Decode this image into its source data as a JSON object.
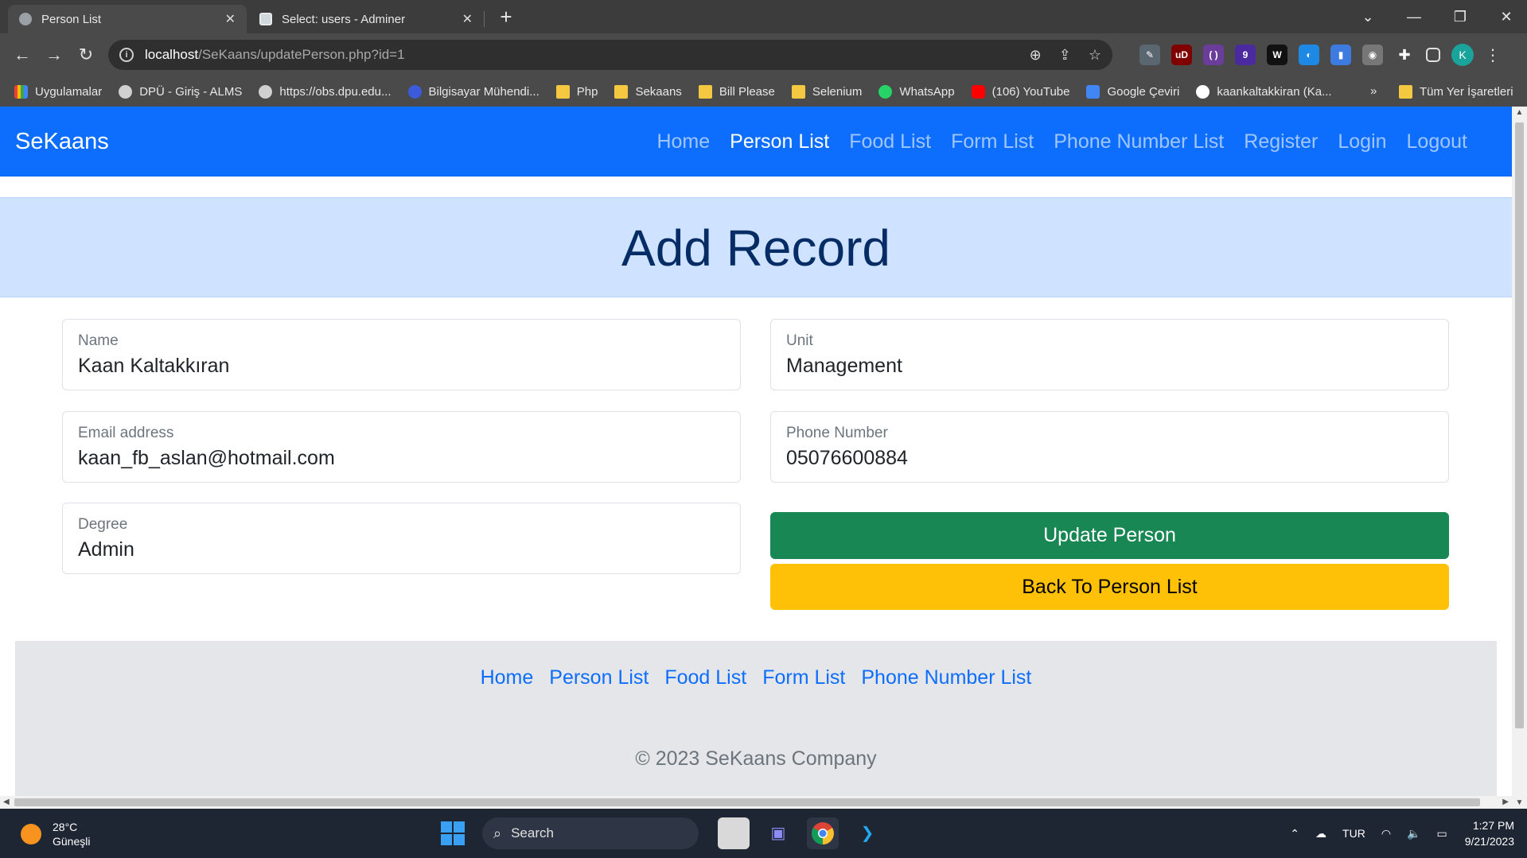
{
  "browser": {
    "tabs": [
      {
        "label": "Person List",
        "active": true
      },
      {
        "label": "Select: users - Adminer",
        "active": false
      }
    ],
    "tab_close": "✕",
    "new_tab": "+",
    "window_controls": {
      "dropdown": "⌄",
      "minimize": "—",
      "restore": "❐",
      "close": "✕"
    },
    "nav": {
      "back": "←",
      "forward": "→",
      "reload": "↻"
    },
    "url": {
      "host": "localhost",
      "path": "/SeKaans/updatePerson.php?id=1"
    },
    "omni_icons": {
      "zoom": "⊕",
      "share": "⇪",
      "star": "☆"
    },
    "extensions": [
      {
        "name": "pen-extension-icon",
        "label": "✎",
        "color": "#5b6770"
      },
      {
        "name": "ublock-extension-icon",
        "label": "uD",
        "color": "#800000"
      },
      {
        "name": "brackets-extension-icon",
        "label": "( )",
        "color": "#6a3d9a"
      },
      {
        "name": "hat-extension-icon",
        "label": "9",
        "color": "#4b2aa0"
      },
      {
        "name": "w-extension-icon",
        "label": "W",
        "color": "#111111"
      },
      {
        "name": "edge-extension-icon",
        "label": "◐",
        "color": "#1e88e5"
      },
      {
        "name": "doc-extension-icon",
        "label": "▮",
        "color": "#3d7be0"
      },
      {
        "name": "circle-extension-icon",
        "label": "◉",
        "color": "#777777"
      }
    ],
    "profile_initial": "K",
    "menu": "⋮",
    "bookmarks": [
      {
        "label": "Uygulamalar",
        "icon": "grid"
      },
      {
        "label": "DPÜ - Giriş - ALMS",
        "icon": "globe"
      },
      {
        "label": "https://obs.dpu.edu...",
        "icon": "globe"
      },
      {
        "label": "Bilgisayar Mühendi...",
        "icon": "bm3"
      },
      {
        "label": "Php",
        "icon": "folder"
      },
      {
        "label": "Sekaans",
        "icon": "folder"
      },
      {
        "label": "Bill Please",
        "icon": "folder"
      },
      {
        "label": "Selenium",
        "icon": "folder"
      },
      {
        "label": "WhatsApp",
        "icon": "wa"
      },
      {
        "label": "(106) YouTube",
        "icon": "yt"
      },
      {
        "label": "Google Çeviri",
        "icon": "gt"
      },
      {
        "label": "kaankaltakkiran (Ka...",
        "icon": "gh"
      }
    ],
    "bookmarks_more": "»",
    "all_bookmarks": "Tüm Yer İşaretleri"
  },
  "site": {
    "brand": "SeKaans",
    "nav": [
      {
        "label": "Home",
        "active": false
      },
      {
        "label": "Person List",
        "active": true
      },
      {
        "label": "Food List",
        "active": false
      },
      {
        "label": "Form List",
        "active": false
      },
      {
        "label": "Phone Number List",
        "active": false
      },
      {
        "label": "Register",
        "active": false
      },
      {
        "label": "Login",
        "active": false
      },
      {
        "label": "Logout",
        "active": false
      }
    ],
    "hero_title": "Add Record",
    "form": {
      "name": {
        "label": "Name",
        "value": "Kaan Kaltakkıran"
      },
      "unit": {
        "label": "Unit",
        "value": "Management"
      },
      "email": {
        "label": "Email address",
        "value": "kaan_fb_aslan@hotmail.com"
      },
      "phone": {
        "label": "Phone Number",
        "value": "05076600884"
      },
      "degree": {
        "label": "Degree",
        "value": "Admin"
      }
    },
    "buttons": {
      "update": "Update Person",
      "back": "Back To Person List"
    },
    "footer": {
      "links": [
        "Home",
        "Person List",
        "Food List",
        "Form List",
        "Phone Number List"
      ],
      "copyright": "© 2023 SeKaans Company"
    }
  },
  "taskbar": {
    "weather": {
      "temp": "28°C",
      "condition": "Güneşli"
    },
    "search_label": "Search",
    "tray": {
      "chevron": "⌃",
      "cloud": "☁",
      "language": "TUR",
      "wifi": "◠",
      "volume": "🔈",
      "battery": "▭"
    },
    "clock": {
      "time": "1:27 PM",
      "date": "9/21/2023"
    }
  },
  "colors": {
    "primary": "#0d6efd",
    "hero_bg": "#cfe2ff",
    "hero_text": "#052c65",
    "success": "#198754",
    "warning": "#ffc107"
  }
}
